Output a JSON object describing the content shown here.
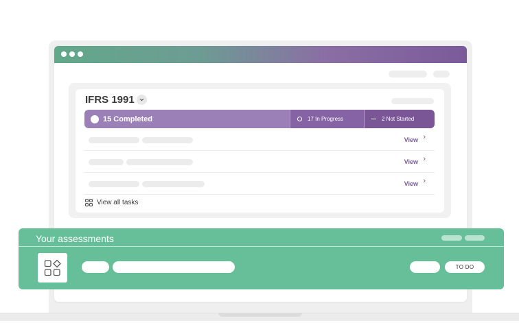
{
  "window": {
    "dots": [
      "dot-1",
      "dot-2",
      "dot-3"
    ]
  },
  "card": {
    "title": "IFRS 1991",
    "dropdown_icon": "chevron-down-icon",
    "status": {
      "completed": "15 Completed",
      "in_progress": "17 In Progress",
      "not_started": "2 Not Started"
    },
    "rows": [
      {
        "action": "View"
      },
      {
        "action": "View"
      },
      {
        "action": "View"
      }
    ],
    "view_all": "View all tasks",
    "view_all_icon": "grid-icon"
  },
  "assessments": {
    "title": "Your assessments",
    "icon": "shapes-icon",
    "badge": "TO DO"
  },
  "colors": {
    "completed": "#9a80b6",
    "in_progress": "#8663a4",
    "not_started": "#7a5696",
    "assessments_bg": "#66bf98",
    "link": "#7a5a98"
  }
}
